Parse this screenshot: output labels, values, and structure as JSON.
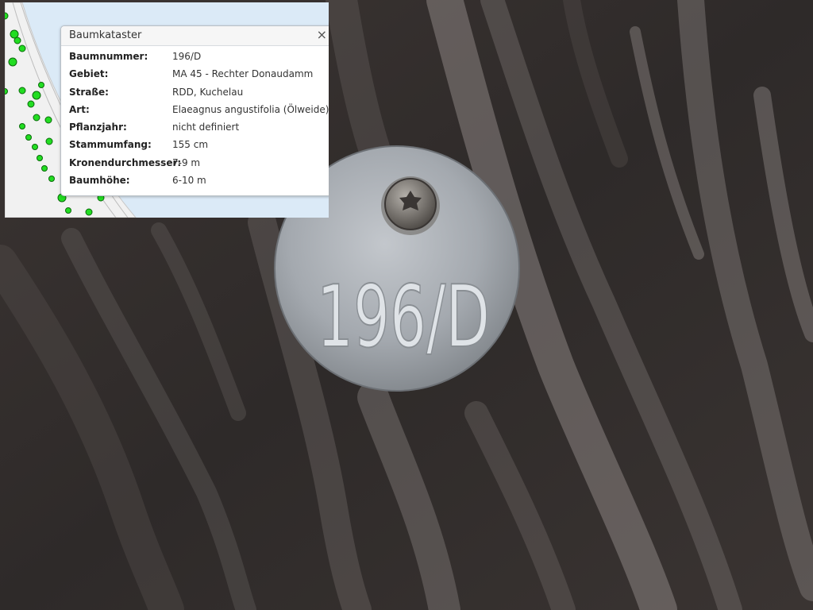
{
  "popup": {
    "title": "Baumkataster",
    "close": "×",
    "rows": [
      {
        "key": "Baumnummer:",
        "value": "196/D"
      },
      {
        "key": "Gebiet:",
        "value": "MA 45 - Rechter Donaudamm"
      },
      {
        "key": "Straße:",
        "value": "RDD, Kuchelau"
      },
      {
        "key": "Art:",
        "value": "Elaeagnus angustifolia (Ölweide)"
      },
      {
        "key": "Pflanzjahr:",
        "value": "nicht definiert"
      },
      {
        "key": "Stammumfang:",
        "value": "155 cm"
      },
      {
        "key": "Kronendurchmesser:",
        "value": "7-9 m"
      },
      {
        "key": "Baumhöhe:",
        "value": "6-10 m"
      }
    ]
  },
  "tag": {
    "engraving": "196/D"
  },
  "colors": {
    "tree_dot": "#22dd22",
    "map_water": "#dbeaf7",
    "bark": "#3b3634",
    "tag_metal": "#a9adb3"
  }
}
